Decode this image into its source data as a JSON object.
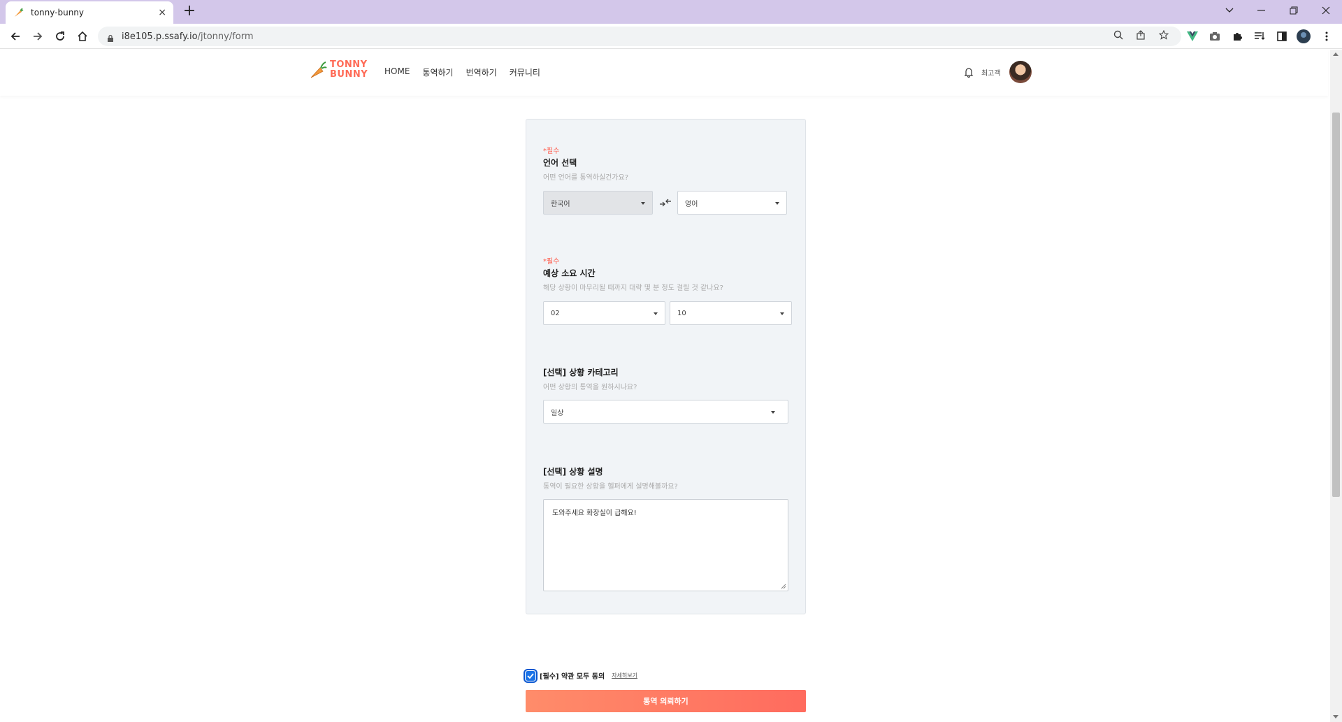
{
  "browser": {
    "tab_title": "tonny-bunny",
    "tab_close": "×",
    "new_tab": "+",
    "url_host": "i8e105.p.ssafy.io",
    "url_path": "/jtonny/form"
  },
  "header": {
    "logo_line1": "TONNY",
    "logo_line2": "BUNNY",
    "menu": [
      "HOME",
      "통역하기",
      "번역하기",
      "커뮤니티"
    ],
    "user_name": "최고객"
  },
  "form": {
    "language": {
      "required": "*필수",
      "title": "언어 선택",
      "desc": "어떤 언어를 통역하실건가요?",
      "from": "한국어",
      "to": "영어"
    },
    "duration": {
      "required": "*필수",
      "title": "예상 소요 시간",
      "desc": "해당 상황이 마무리될 때까지 대략 몇 분 정도 걸릴 것 같나요?",
      "hours": "02",
      "minutes": "10"
    },
    "category": {
      "title": "[선택] 상황 카테고리",
      "desc": "어떤 상황의 통역을 원하시나요?",
      "value": "일상"
    },
    "description": {
      "title": "[선택] 상황 설명",
      "desc": "통역이 필요한 상황을 헬퍼에게 설명해볼까요?",
      "value": "도와주세요 화장실이 급해요!"
    }
  },
  "agreement": {
    "checked": true,
    "label": "[필수] 약관 모두 동의",
    "detail_link": "자세히보기"
  },
  "submit_label": "통역 의뢰하기",
  "colors": {
    "tab_bar": "#d3c7ea",
    "accent": "#ff6b57",
    "required": "#ff5a4a",
    "card_bg": "#f1f4f7",
    "checkbox": "#1a73e8"
  }
}
